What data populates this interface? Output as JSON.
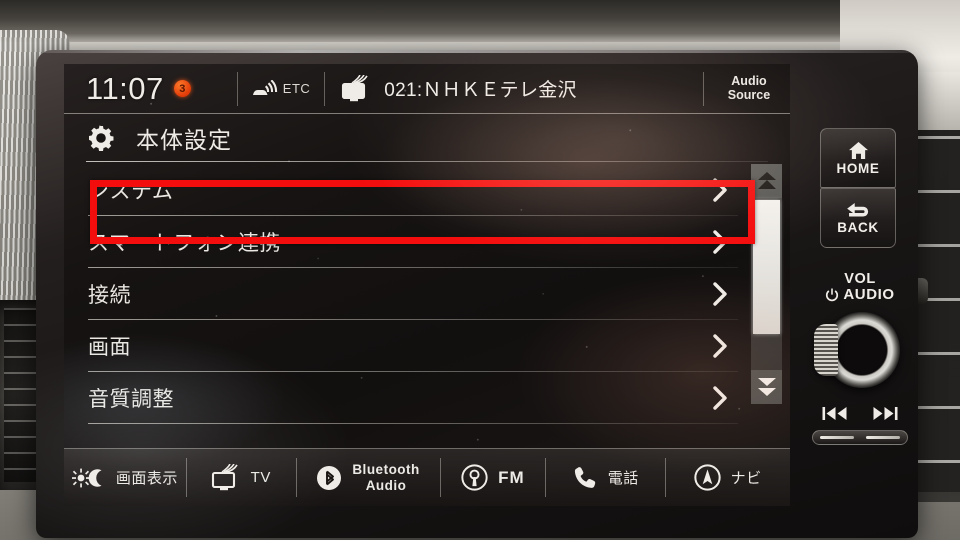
{
  "device": {
    "name": "car-infotainment-head-unit",
    "accent_red": "#f40d0d",
    "screen_text_color": "#ebe8e3"
  },
  "status_bar": {
    "clock": "11:07",
    "notification_badge": "3",
    "etc_label": "ETC",
    "etc_icon": "etc-car-signal-icon",
    "tv_icon": "tv-antenna-icon",
    "station": "021:ＮＨＫＥテレ金沢",
    "audio_source_line1": "Audio",
    "audio_source_line2": "Source"
  },
  "settings": {
    "gear_icon": "gear-icon",
    "title": "本体設定",
    "items": [
      {
        "label": "システム",
        "chevron": "chevron-right-icon",
        "highlighted": false
      },
      {
        "label": "スマートフォン連携",
        "chevron": "chevron-right-icon",
        "highlighted": true
      },
      {
        "label": "接続",
        "chevron": "chevron-right-icon",
        "highlighted": false
      },
      {
        "label": "画面",
        "chevron": "chevron-right-icon",
        "highlighted": false
      },
      {
        "label": "音質調整",
        "chevron": "chevron-right-icon",
        "highlighted": false
      }
    ]
  },
  "scrollbar": {
    "up_icon": "scroll-up-arrow-icon",
    "down_icon": "scroll-down-arrow-icon"
  },
  "bottom_bar": {
    "items": [
      {
        "label": "画面表示",
        "icon": "brightness-sun-moon-icon",
        "style": "normal"
      },
      {
        "label": "TV",
        "icon": "tv-antenna-icon",
        "style": "normal"
      },
      {
        "label": "Bluetooth\nAudio",
        "label_line1": "Bluetooth",
        "label_line2": "Audio",
        "icon": "bluetooth-icon",
        "style": "two-line"
      },
      {
        "label": "FM",
        "icon": "radio-broadcast-icon",
        "style": "bold"
      },
      {
        "label": "電話",
        "icon": "phone-handset-icon",
        "style": "normal"
      },
      {
        "label": "ナビ",
        "icon": "navigation-compass-icon",
        "style": "normal"
      }
    ]
  },
  "hardware": {
    "home_button": {
      "label": "HOME",
      "icon": "home-icon"
    },
    "back_button": {
      "label": "BACK",
      "icon": "back-arrow-icon"
    },
    "volume_knob": {
      "line1": "VOL",
      "line2": "AUDIO",
      "power_icon": "power-icon",
      "control": "rotary-knob"
    },
    "prev_track_icon": "previous-track-icon",
    "next_track_icon": "next-track-icon",
    "seek_bar": "seek-slider"
  }
}
